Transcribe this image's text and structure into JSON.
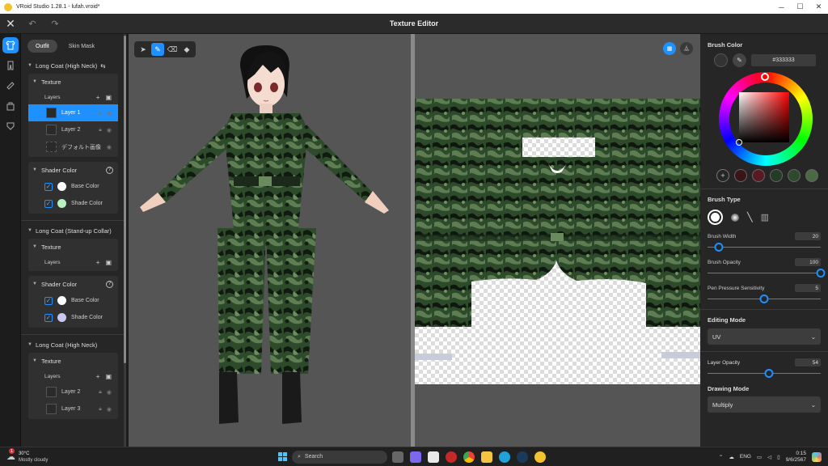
{
  "window": {
    "title": "VRoid Studio 1.28.1 - lufah.vroid*",
    "minimize": "─",
    "maximize": "☐",
    "close": "✕"
  },
  "header": {
    "title": "Texture Editor",
    "close_glyph": "✕",
    "undo_glyph": "↶",
    "redo_glyph": "↷"
  },
  "left_panel": {
    "tabs": [
      {
        "label": "Outfit"
      },
      {
        "label": "Skin Mask"
      }
    ],
    "sections": [
      {
        "title": "Long Coat (High Neck)",
        "texture": {
          "title": "Texture",
          "layers_label": "Layers",
          "layers": [
            {
              "name": "Layer 1",
              "selected": true
            },
            {
              "name": "Layer 2",
              "selected": false
            },
            {
              "name": "デフォルト画像",
              "selected": false
            }
          ]
        },
        "shader": {
          "title": "Shader Color",
          "base": "Base Color",
          "shade": "Shade Color",
          "base_color": "#ffffff",
          "shade_color": "#b9f0c0"
        }
      },
      {
        "title": "Long Coat (Stand-up Collar)",
        "texture": {
          "title": "Texture",
          "layers_label": "Layers"
        },
        "shader": {
          "title": "Shader Color",
          "base": "Base Color",
          "shade": "Shade Color",
          "base_color": "#ffffff",
          "shade_color": "#c8c8f2"
        }
      },
      {
        "title": "Long Coat (High Neck)",
        "texture": {
          "title": "Texture",
          "layers_label": "Layers",
          "layers": [
            {
              "name": "Layer 2"
            },
            {
              "name": "Layer 3"
            }
          ]
        }
      }
    ]
  },
  "right_panel": {
    "brush_color": {
      "title": "Brush Color",
      "hex": "#333333",
      "current_color": "#333333",
      "presets": [
        "#3a1518",
        "#5a1a22",
        "#243b25",
        "#2e4a2e",
        "#4a6a44"
      ]
    },
    "brush_type": {
      "title": "Brush Type"
    },
    "brush_width": {
      "label": "Brush Width",
      "value": "20",
      "fraction": 0.1
    },
    "brush_opacity": {
      "label": "Brush Opacity",
      "value": "100",
      "fraction": 1.0
    },
    "pen_pressure": {
      "label": "Pen Pressure Sensitivity",
      "value": "5",
      "fraction": 0.5
    },
    "editing_mode": {
      "title": "Editing Mode",
      "value": "UV"
    },
    "layer_opacity": {
      "label": "Layer Opacity",
      "value": "54",
      "fraction": 0.54
    },
    "drawing_mode": {
      "title": "Drawing Mode",
      "value": "Multiply"
    }
  },
  "taskbar": {
    "weather_temp": "30°C",
    "weather_desc": "Mostly cloudy",
    "search_label": "Search",
    "lang": "ENG",
    "time": "0:15",
    "date": "9/6/2567",
    "notification_count": "1"
  },
  "colors": {
    "accent": "#1e90ff",
    "camo_dark": "#1f3a1f",
    "camo_mid": "#355a35",
    "camo_light": "#5f7f55"
  }
}
